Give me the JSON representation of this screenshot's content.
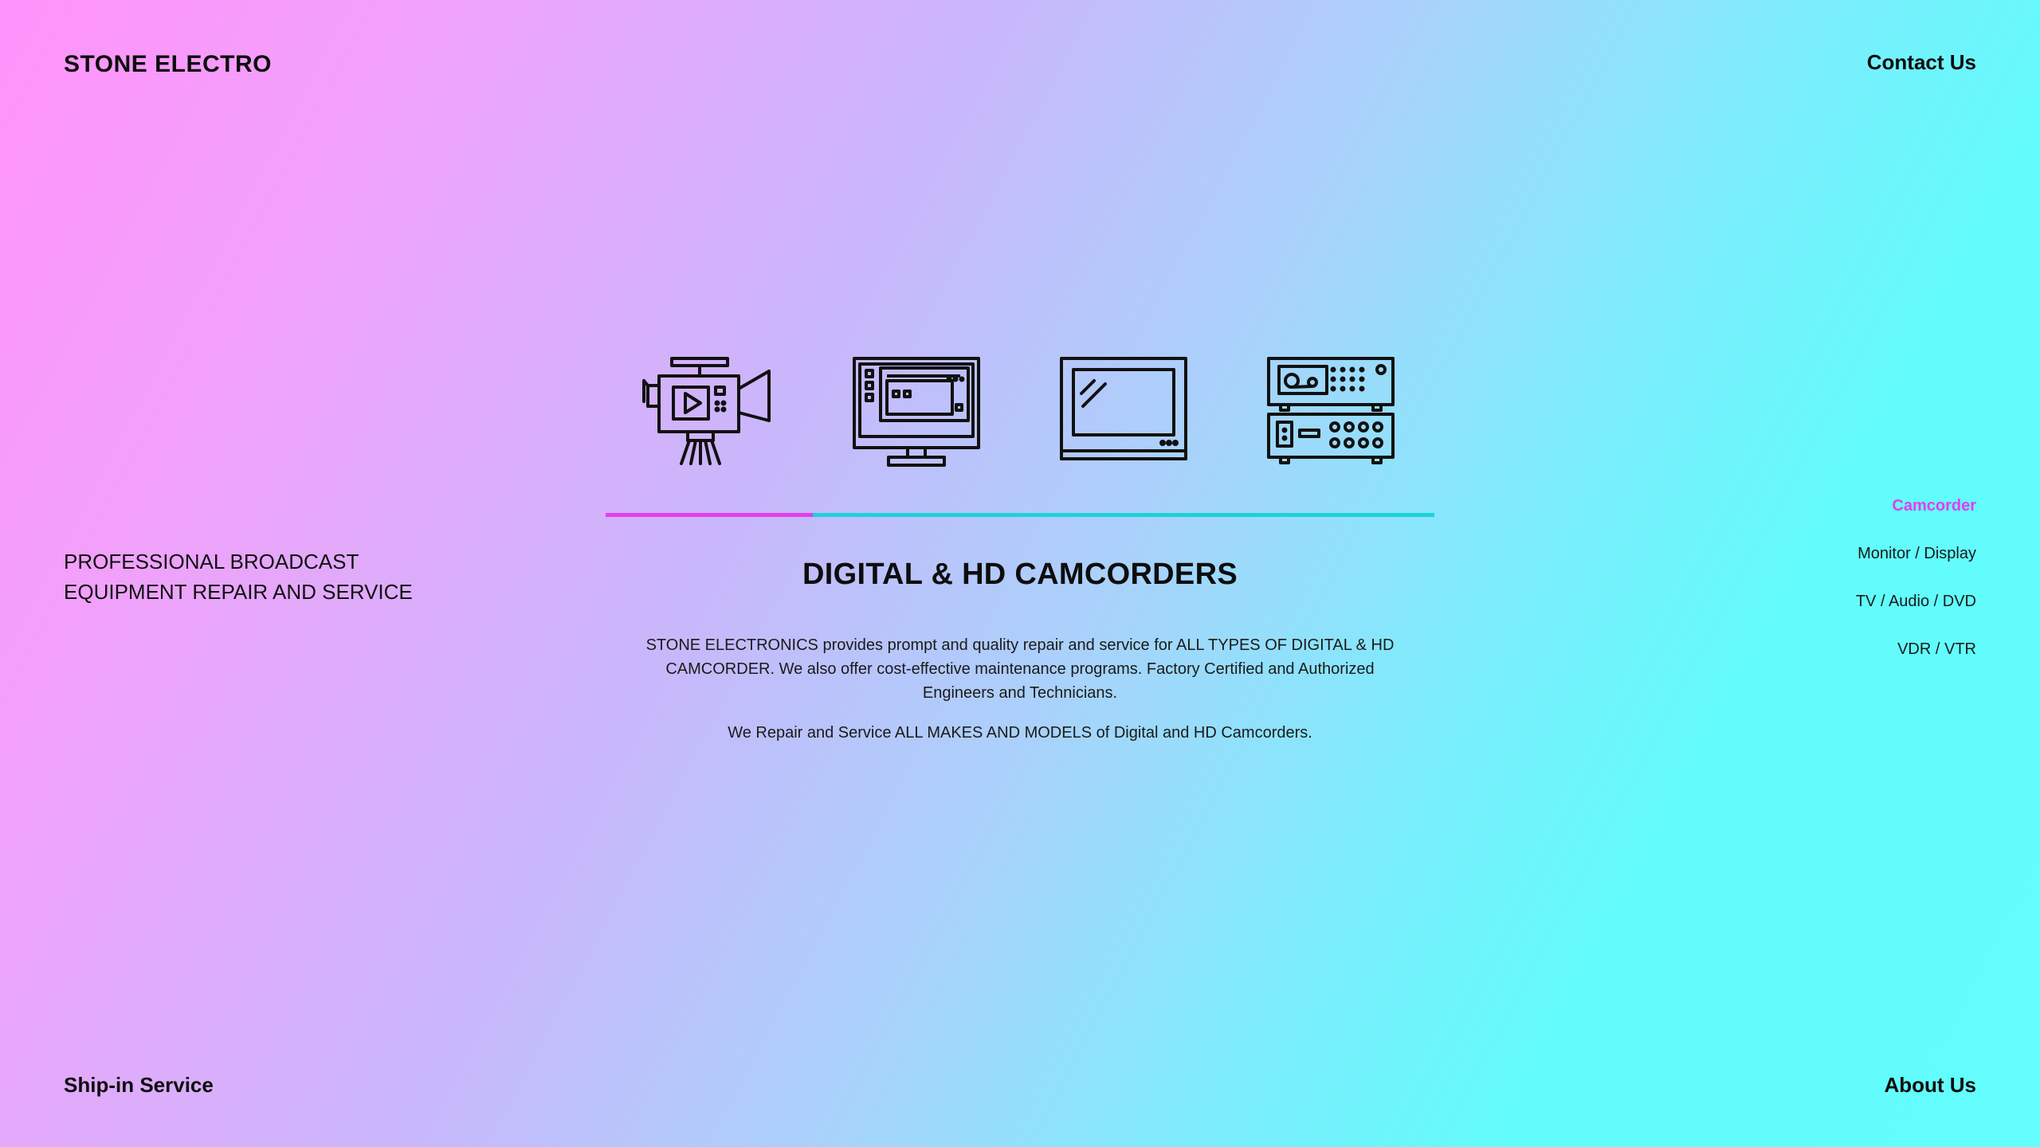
{
  "header": {
    "brand": "STONE ELECTRO",
    "contact_label": "Contact Us"
  },
  "tagline": {
    "line1": "PROFESSIONAL BROADCAST",
    "line2": "EQUIPMENT REPAIR AND SERVICE"
  },
  "icons": [
    "camcorder-icon",
    "monitor-icon",
    "tv-icon",
    "vcr-deck-icon"
  ],
  "colors": {
    "accent_active": "#e23ef0",
    "accent_bar": "#1ed1d9",
    "gradient_start": "#ff93fb",
    "gradient_end": "#62fdfc"
  },
  "main": {
    "title": "DIGITAL & HD CAMCORDERS",
    "paragraph1": "STONE ELECTRONICS provides prompt and quality repair and service for ALL TYPES OF DIGITAL & HD CAMCORDER. We also offer cost-effective maintenance programs. Factory Certified and Authorized Engineers and Technicians.",
    "paragraph2": "We Repair and Service ALL MAKES AND MODELS of Digital and HD Camcorders."
  },
  "sidenav": {
    "items": [
      {
        "label": "Camcorder",
        "active": true
      },
      {
        "label": "Monitor / Display",
        "active": false
      },
      {
        "label": "TV / Audio / DVD",
        "active": false
      },
      {
        "label": "VDR / VTR",
        "active": false
      }
    ]
  },
  "footer": {
    "ship_label": "Ship-in Service",
    "about_label": "About Us"
  }
}
